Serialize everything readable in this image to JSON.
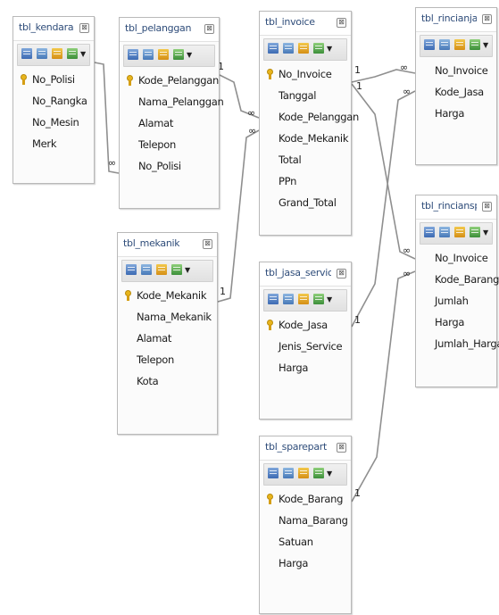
{
  "tables": [
    {
      "id": "kendaraan",
      "title": "tbl_kendaraan",
      "fields": [
        {
          "name": "No_Polisi",
          "pk": true
        },
        {
          "name": "No_Rangka"
        },
        {
          "name": "No_Mesin"
        },
        {
          "name": "Merk"
        }
      ]
    },
    {
      "id": "pelanggan",
      "title": "tbl_pelanggan",
      "fields": [
        {
          "name": "Kode_Pelanggan",
          "pk": true
        },
        {
          "name": "Nama_Pelanggan"
        },
        {
          "name": "Alamat"
        },
        {
          "name": "Telepon"
        },
        {
          "name": "No_Polisi"
        }
      ]
    },
    {
      "id": "invoice",
      "title": "tbl_invoice",
      "fields": [
        {
          "name": "No_Invoice",
          "pk": true
        },
        {
          "name": "Tanggal"
        },
        {
          "name": "Kode_Pelanggan"
        },
        {
          "name": "Kode_Mekanik"
        },
        {
          "name": "Total"
        },
        {
          "name": "PPn"
        },
        {
          "name": "Grand_Total"
        }
      ]
    },
    {
      "id": "rincianjasa",
      "title": "tbl_rincianjasa",
      "fields": [
        {
          "name": "No_Invoice"
        },
        {
          "name": "Kode_Jasa"
        },
        {
          "name": "Harga"
        }
      ]
    },
    {
      "id": "mekanik",
      "title": "tbl_mekanik",
      "fields": [
        {
          "name": "Kode_Mekanik",
          "pk": true
        },
        {
          "name": "Nama_Mekanik"
        },
        {
          "name": "Alamat"
        },
        {
          "name": "Telepon"
        },
        {
          "name": "Kota"
        }
      ]
    },
    {
      "id": "rinciansparepart",
      "title": "tbl_rinciansparе...",
      "fields": [
        {
          "name": "No_Invoice"
        },
        {
          "name": "Kode_Barang"
        },
        {
          "name": "Jumlah"
        },
        {
          "name": "Harga"
        },
        {
          "name": "Jumlah_Harga"
        }
      ]
    },
    {
      "id": "jasaservice",
      "title": "tbl_jasa_service",
      "fields": [
        {
          "name": "Kode_Jasa",
          "pk": true
        },
        {
          "name": "Jenis_Service"
        },
        {
          "name": "Harga"
        }
      ]
    },
    {
      "id": "sparepart",
      "title": "tbl_sparepart",
      "fields": [
        {
          "name": "Kode_Barang",
          "pk": true
        },
        {
          "name": "Nama_Barang"
        },
        {
          "name": "Satuan"
        },
        {
          "name": "Harga"
        }
      ]
    }
  ],
  "close_glyph": "⊠",
  "toolbar_arrow": "▼",
  "cardinality": {
    "one": "1",
    "many": "∞"
  },
  "relations": [
    {
      "from": "kendaraan",
      "to": "pelanggan",
      "from_card": "1",
      "to_card": "∞"
    },
    {
      "from": "pelanggan",
      "to": "invoice",
      "from_card": "1",
      "to_card": "∞"
    },
    {
      "from": "mekanik",
      "to": "invoice",
      "from_card": "1",
      "to_card": "∞"
    },
    {
      "from": "invoice",
      "to": "rincianjasa",
      "from_card": "1",
      "to_card": "∞"
    },
    {
      "from": "invoice",
      "to": "rinciansparepart",
      "from_card": "1",
      "to_card": "∞"
    },
    {
      "from": "jasaservice",
      "to": "rincianjasa",
      "from_card": "1",
      "to_card": "∞"
    },
    {
      "from": "sparepart",
      "to": "rinciansparepart",
      "from_card": "1",
      "to_card": "∞"
    }
  ]
}
